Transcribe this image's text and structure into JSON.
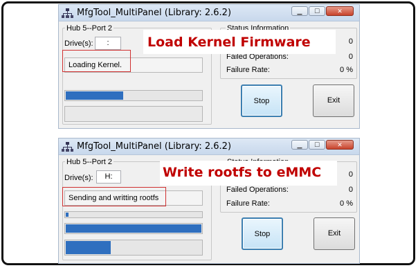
{
  "panels": [
    {
      "window_title": "MfgTool_MultiPanel (Library: 2.6.2)",
      "hub_label": "Hub 5--Port 2",
      "drive_label": "Drive(s):",
      "drive_value": ":",
      "status_text": "Loading Kernel.",
      "progress_fraction": 0.43,
      "status_group_label": "Status Information",
      "successful_value": "0",
      "failed_label": "Failed Operations:",
      "failed_value": "0",
      "failure_rate_label": "Failure Rate:",
      "failure_rate_value": "0 %",
      "stop_label": "Stop",
      "exit_label": "Exit",
      "annotation": "Load Kernel Firmware"
    },
    {
      "window_title": "MfgTool_MultiPanel (Library: 2.6.2)",
      "hub_label": "Hub 5--Port 2",
      "drive_label": "Drive(s):",
      "drive_value": "H:",
      "status_text": "Sending and writting rootfs",
      "progress_fraction_1": 0.03,
      "progress_fraction_2": 1.0,
      "progress_fraction_3": 0.34,
      "status_group_label": "Status Information",
      "successful_value": "0",
      "failed_label": "Failed Operations:",
      "failed_value": "0",
      "failure_rate_label": "Failure Rate:",
      "failure_rate_value": "0 %",
      "stop_label": "Stop",
      "exit_label": "Exit",
      "annotation": "Write rootfs to eMMC"
    }
  ],
  "icons": {
    "app": "usb-tree-icon",
    "minimize": "minimize-icon",
    "maximize": "maximize-icon",
    "close": "close-icon"
  },
  "colors": {
    "progress_fill": "#2f6fbf",
    "annotation_text": "#c00000",
    "highlight_box": "#d03030"
  }
}
